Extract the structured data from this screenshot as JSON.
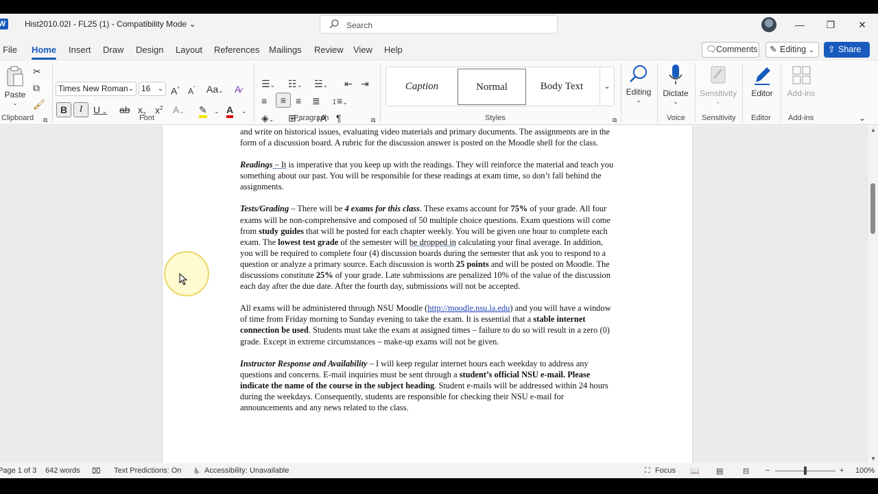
{
  "window": {
    "title": "Hist2010.02I - FL25 (1)  -  Compatibility Mode",
    "search_placeholder": "Search"
  },
  "tabs": [
    "File",
    "Home",
    "Insert",
    "Draw",
    "Design",
    "Layout",
    "References",
    "Mailings",
    "Review",
    "View",
    "Help"
  ],
  "active_tab": "Home",
  "header_buttons": {
    "comments": "Comments",
    "editing": "Editing",
    "share": "Share"
  },
  "ribbon": {
    "clipboard": {
      "paste": "Paste",
      "label": "Clipboard"
    },
    "font": {
      "name": "Times New Roman",
      "size": "16",
      "label": "Font"
    },
    "paragraph": {
      "label": "Paragraph"
    },
    "styles": {
      "items": [
        "Caption",
        "Normal",
        "Body Text"
      ],
      "selected": "Normal",
      "label": "Styles"
    },
    "editing": {
      "button": "Editing"
    },
    "voice": {
      "button": "Dictate",
      "label": "Voice"
    },
    "sensitivity": {
      "button": "Sensitivity",
      "label": "Sensitivity"
    },
    "editor": {
      "button": "Editor",
      "label": "Editor"
    },
    "addins": {
      "button": "Add-ins",
      "label": "Add-ins"
    }
  },
  "document": {
    "p1": "and write on historical issues, evaluating video materials and primary documents.  The assignments are in the form of a discussion board.  A rubric for the discussion answer is posted on the Moodle shell for the class.",
    "readings": {
      "heading": "Readings",
      "dash": " – ",
      "first_word": "It",
      "body": " is imperative that you keep up with the readings.  They will reinforce the material and teach you something about our past.  You will be responsible for these readings at exam time, so don’t fall behind the assignments."
    },
    "tests": {
      "heading": "Tests/Grading",
      "t1": " – There will be ",
      "b1": "4 exams for this class",
      "t2": ".  These exams account for ",
      "b2": "75%",
      "t3": " of your grade.  All four exams will be non-comprehensive and composed of 50 multiple choice questions.  Exam questions will come from ",
      "b3": "study guides",
      "t4": " that will be posted for each chapter weekly.  You will be given one hour to complete each exam.  The ",
      "b4": "lowest test grade",
      "t5": " of the semester will ",
      "u1": "be dropped in",
      "t6": " calculating your final average.  In addition, you will be required to complete four (4) discussion boards during the semester that ask you to respond to a question or analyze a primary source.  Each discussion is worth ",
      "b5": "25 points",
      "t7": " and will be posted on Moodle.  The discussions constitute ",
      "b6": "25%",
      "t8": " of your grade. Late submissions are penalized 10% of the value of the discussion each day after the due date.  After the fourth day, submissions will not be accepted."
    },
    "exams": {
      "t1": "All exams will be administered through NSU Moodle (",
      "link": "http://moodle.nsu.la.edu",
      "t2": ") and you will have a window of time from Friday morning to Sunday evening to take the exam.  It is essential that a ",
      "b1": "stable internet connection be used",
      "t3": ".  Students must take the exam at assigned times – failure to do so will result in a zero (0) grade.  Except in extreme circumstances – make-up exams will not be given."
    },
    "instructor": {
      "heading": "Instructor Response and Availability",
      "t1": " – I will keep regular internet hours each weekday to address any questions and concerns.  E-mail inquiries must be sent through a ",
      "b1": "student’s official NSU e-mail.  Please indicate the name of the course in the subject heading",
      "t2": ".  Student e-mails will be addressed within 24 hours during the weekdays.  Consequently, students are responsible for checking their NSU e-mail for announcements and any news related to the class."
    }
  },
  "status": {
    "page": "Page 1 of 3",
    "words": "642 words",
    "text_predictions": "Text Predictions: On",
    "accessibility": "Accessibility: Unavailable",
    "focus": "Focus",
    "zoom": "100%"
  },
  "colors": {
    "accent": "#185abd",
    "ribbon_bg": "#fafafa",
    "chrome_bg": "#f3f3f3"
  }
}
